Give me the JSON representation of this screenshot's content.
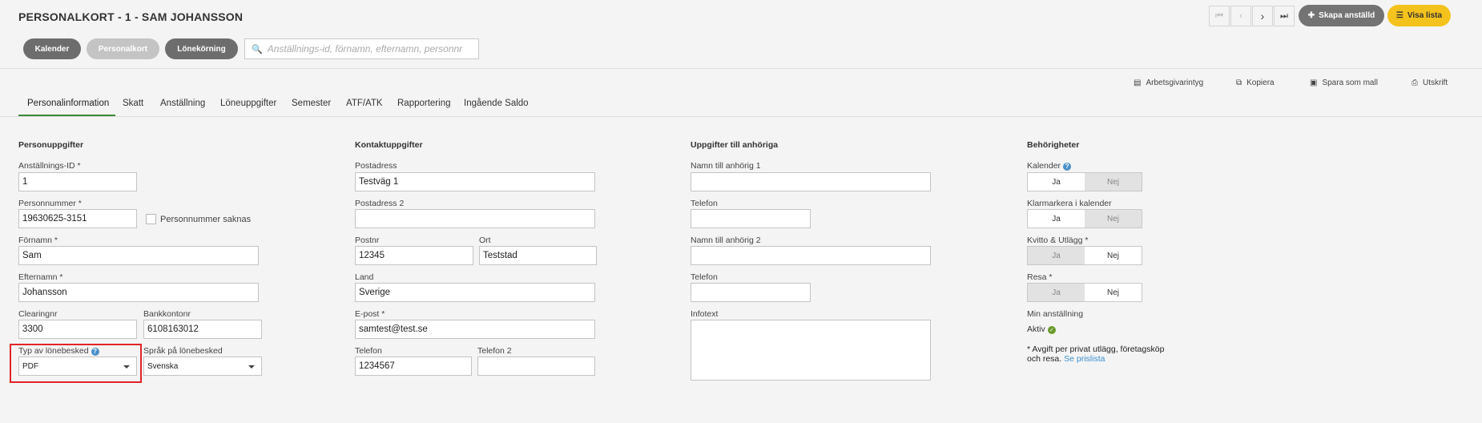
{
  "header": {
    "title": "PERSONALKORT - 1 - SAM JOHANSSON",
    "nav_buttons": [
      "first-icon",
      "prev-icon",
      "next-icon",
      "last-icon"
    ],
    "create_label": "Skapa anställd",
    "list_label": "Visa lista"
  },
  "pills": {
    "kalender": "Kalender",
    "personalkort": "Personalkort",
    "lonekorning": "Lönekörning"
  },
  "search": {
    "placeholder": "Anställnings-id, förnamn, efternamn, personnr"
  },
  "actions": {
    "arbetsgivarintyg": "Arbetsgivarintyg",
    "kopiera": "Kopiera",
    "spara_mall": "Spara som mall",
    "utskrift": "Utskrift"
  },
  "tabs": [
    {
      "label": "Personalinformation",
      "active": true
    },
    {
      "label": "Skatt"
    },
    {
      "label": "Anställning"
    },
    {
      "label": "Löneuppgifter"
    },
    {
      "label": "Semester"
    },
    {
      "label": "ATF/ATK"
    },
    {
      "label": "Rapportering"
    },
    {
      "label": "Ingående Saldo"
    }
  ],
  "person": {
    "heading": "Personuppgifter",
    "id_label": "Anställnings-ID *",
    "id_value": "1",
    "pnr_label": "Personnummer *",
    "pnr_value": "19630625-3151",
    "pnr_missing_label": "Personnummer saknas",
    "firstname_label": "Förnamn *",
    "firstname_value": "Sam",
    "lastname_label": "Efternamn *",
    "lastname_value": "Johansson",
    "clearing_label": "Clearingnr",
    "clearing_value": "3300",
    "bank_label": "Bankkontonr",
    "bank_value": "6108163012",
    "payslip_type_label": "Typ av lönebesked",
    "payslip_type_value": "PDF",
    "payslip_lang_label": "Språk på lönebesked",
    "payslip_lang_value": "Svenska"
  },
  "contact": {
    "heading": "Kontaktuppgifter",
    "address_label": "Postadress",
    "address_value": "Testväg 1",
    "address2_label": "Postadress 2",
    "address2_value": "",
    "postnr_label": "Postnr",
    "postnr_value": "12345",
    "ort_label": "Ort",
    "ort_value": "Teststad",
    "land_label": "Land",
    "land_value": "Sverige",
    "email_label": "E-post *",
    "email_value": "samtest@test.se",
    "phone_label": "Telefon",
    "phone_value": "1234567",
    "phone2_label": "Telefon 2",
    "phone2_value": ""
  },
  "relatives": {
    "heading": "Uppgifter till anhöriga",
    "name1_label": "Namn till anhörig 1",
    "phone1_label": "Telefon",
    "name2_label": "Namn till anhörig 2",
    "phone2_label": "Telefon",
    "info_label": "Infotext"
  },
  "perms": {
    "heading": "Behörigheter",
    "yes": "Ja",
    "no": "Nej",
    "kalender_label": "Kalender",
    "kalender_value": "Ja",
    "klarmarkera_label": "Klarmarkera i kalender",
    "klarmarkera_value": "Ja",
    "kvitto_label": "Kvitto & Utlägg *",
    "kvitto_value": "Nej",
    "resa_label": "Resa *",
    "resa_value": "Nej",
    "min_anst_label": "Min anställning",
    "min_anst_value": "Aktiv",
    "footnote_line1": "* Avgift per privat utlägg, företagsköp",
    "footnote_line2": "och resa.",
    "footnote_link": "Se prislista"
  },
  "colors": {
    "accent_yellow": "#f4c21c",
    "pill_gray": "#6d6d6d",
    "tab_underline": "#3a8a3a",
    "highlight_red": "#e0242a",
    "link_blue": "#3b8fd0"
  }
}
